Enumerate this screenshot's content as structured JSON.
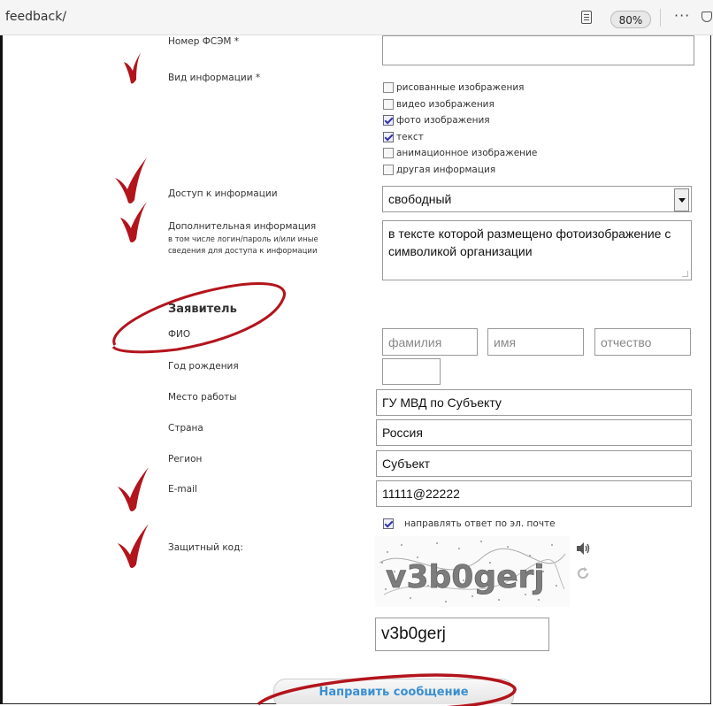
{
  "browser": {
    "url": "feedback/",
    "zoom": "80%",
    "more_label": "···"
  },
  "form": {
    "fsem_number": {
      "label": "Номер ФСЭМ *",
      "value": ""
    },
    "info_type": {
      "label": "Вид информации *",
      "options": [
        {
          "label": "рисованные изображения",
          "checked": false
        },
        {
          "label": "видео изображения",
          "checked": false
        },
        {
          "label": "фото изображения",
          "checked": true
        },
        {
          "label": "текст",
          "checked": true
        },
        {
          "label": "анимационное изображение",
          "checked": false
        },
        {
          "label": "другая информация",
          "checked": false
        }
      ]
    },
    "access": {
      "label": "Доступ к информации",
      "value": "свободный"
    },
    "additional": {
      "label": "Дополнительная информация",
      "sub_line1": "в том числе логин/пароль и/или иные",
      "sub_line2": "сведения для доступа к информации",
      "value": "в тексте которой размещено фотоизображение с символикой организации"
    },
    "applicant_heading": "Заявитель",
    "fio": {
      "label": "ФИО",
      "surname_placeholder": "фамилия",
      "name_placeholder": "имя",
      "patronymic_placeholder": "отчество"
    },
    "birth_year": {
      "label": "Год рождения",
      "value": ""
    },
    "workplace": {
      "label": "Место работы",
      "value": "ГУ МВД по Субъекту"
    },
    "country": {
      "label": "Страна",
      "value": "Россия"
    },
    "region": {
      "label": "Регион",
      "value": "Субъект"
    },
    "email": {
      "label": "E-mail",
      "value": "11111@22222"
    },
    "reply_by_email": {
      "label": "направлять ответ по эл. почте",
      "checked": true
    },
    "captcha": {
      "label": "Защитный код:",
      "image_text": "v3b0gerj",
      "value": "v3b0gerj"
    },
    "submit_label": "Направить сообщение"
  },
  "colors": {
    "annotation_red": "#b3141c",
    "submit_text": "#3a8fd0"
  }
}
